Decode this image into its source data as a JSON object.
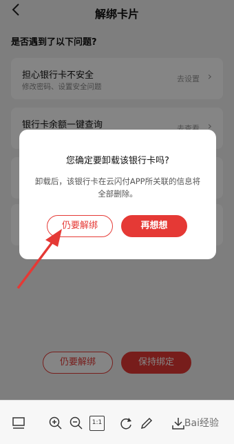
{
  "header": {
    "back_icon": "chevron-left-icon",
    "title": "解绑卡片"
  },
  "question": "是否遇到了以下问题?",
  "cards": [
    {
      "title": "担心银行卡不安全",
      "subtitle": "修改密码、设置安全问题",
      "action": "去设置"
    },
    {
      "title": "银行卡余额一键查询",
      "subtitle": "",
      "action": "去查看"
    },
    {
      "title": "",
      "subtitle": "",
      "action": ""
    },
    {
      "title": "",
      "subtitle": "",
      "action": ""
    }
  ],
  "bottom_buttons": {
    "unbind": "仍要解绑",
    "keep": "保持绑定"
  },
  "dialog": {
    "title": "您确定要卸载该银行卡吗?",
    "message": "卸载后，该银行卡在云闪付APP所关联的信息将全部删除。",
    "unbind_label": "仍要解绑",
    "rethink_label": "再想想"
  },
  "toolbar": {
    "icons": [
      "layout-icon",
      "zoom-in-icon",
      "zoom-out-icon",
      "actual-size-icon",
      "rotate-icon",
      "edit-icon",
      "download-icon"
    ],
    "actual_size_label": "1:1",
    "watermark": "Bai经验"
  },
  "colors": {
    "accent": "#e53935",
    "overlay": "rgba(0,0,0,0.48)"
  }
}
